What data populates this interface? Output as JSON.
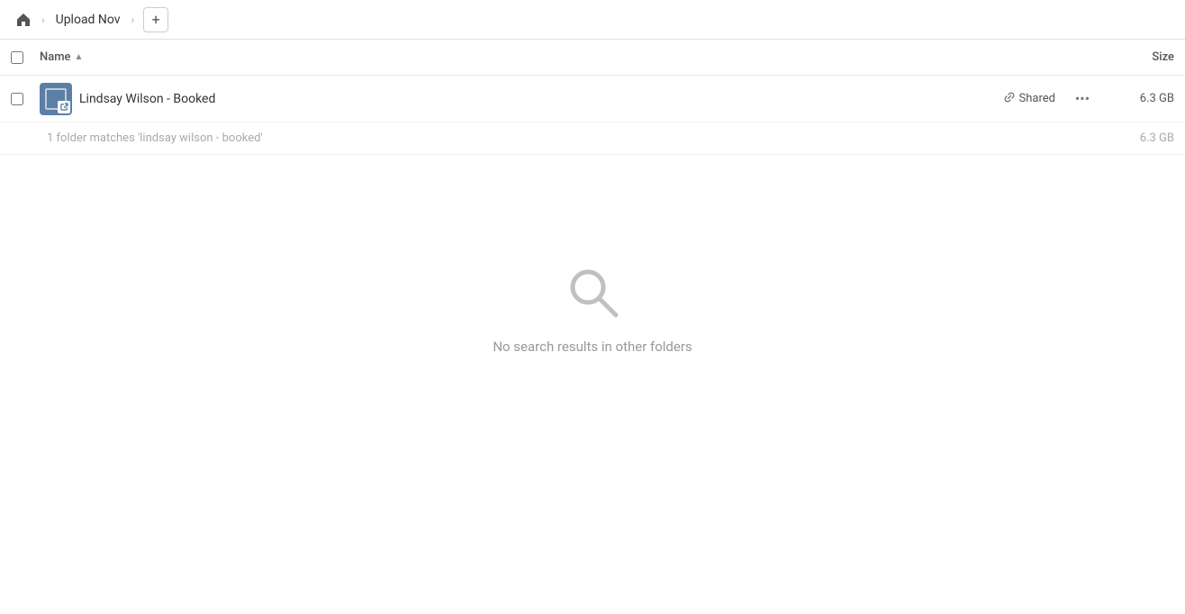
{
  "topbar": {
    "home_label": "Home",
    "breadcrumb_item": "Upload Nov",
    "add_button_label": "+"
  },
  "table": {
    "name_column": "Name",
    "size_column": "Size"
  },
  "file_row": {
    "name": "Lindsay Wilson - Booked",
    "shared_label": "Shared",
    "size": "6.3 GB",
    "more_icon": "•••"
  },
  "folder_match": {
    "text": "1 folder matches 'lindsay wilson - booked'",
    "size": "6.3 GB"
  },
  "empty_state": {
    "text": "No search results in other folders"
  }
}
